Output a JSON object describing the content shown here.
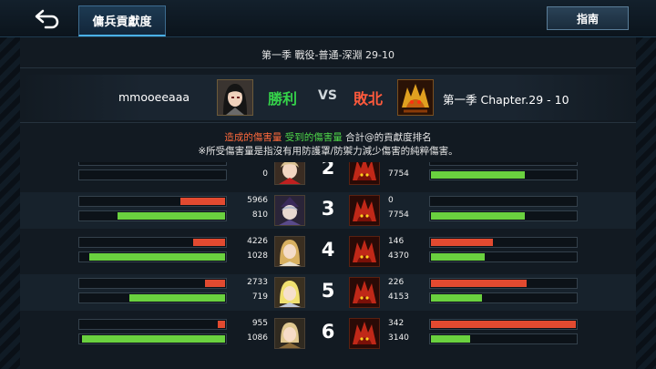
{
  "header": {
    "title": "傭兵貢獻度",
    "guide_label": "指南"
  },
  "match": {
    "season_line": "第一季 戰役-普通-深淵 29-10",
    "player_name": "mmooeeaaa",
    "result_player": "勝利",
    "vs": "VS",
    "result_enemy": "敗北",
    "enemy_name": "第一季 Chapter.29 - 10"
  },
  "legend": {
    "dealt": "造成的傷害量",
    "taken": "受到的傷害量",
    "rest": "合計@的貢獻度排名",
    "note": "※所受傷害量是指沒有用防護罩/防禦力減少傷害的純粹傷害。"
  },
  "colors": {
    "damage_dealt": "#e24a30",
    "damage_taken": "#6ad13f",
    "win": "#35d24a",
    "lose": "#ff5a3c"
  },
  "ranks": [
    {
      "rank": "2",
      "ally_dealt": "",
      "ally_taken": "0",
      "ally_dealt_frac": 0.0,
      "ally_taken_frac": 0.0,
      "enemy_dealt": "",
      "enemy_taken": "7754",
      "enemy_dealt_frac": 0.0,
      "enemy_taken_frac": 0.65
    },
    {
      "rank": "3",
      "ally_dealt": "5966",
      "ally_taken": "810",
      "ally_dealt_frac": 0.31,
      "ally_taken_frac": 0.74,
      "enemy_dealt": "0",
      "enemy_taken": "7754",
      "enemy_dealt_frac": 0.0,
      "enemy_taken_frac": 0.65
    },
    {
      "rank": "4",
      "ally_dealt": "4226",
      "ally_taken": "1028",
      "ally_dealt_frac": 0.22,
      "ally_taken_frac": 0.94,
      "enemy_dealt": "146",
      "enemy_taken": "4370",
      "enemy_dealt_frac": 0.43,
      "enemy_taken_frac": 0.37
    },
    {
      "rank": "5",
      "ally_dealt": "2733",
      "ally_taken": "719",
      "ally_dealt_frac": 0.14,
      "ally_taken_frac": 0.66,
      "enemy_dealt": "226",
      "enemy_taken": "4153",
      "enemy_dealt_frac": 0.66,
      "enemy_taken_frac": 0.35
    },
    {
      "rank": "6",
      "ally_dealt": "955",
      "ally_taken": "1086",
      "ally_dealt_frac": 0.05,
      "ally_taken_frac": 0.99,
      "enemy_dealt": "342",
      "enemy_taken": "3140",
      "enemy_dealt_frac": 1.0,
      "enemy_taken_frac": 0.27
    }
  ]
}
